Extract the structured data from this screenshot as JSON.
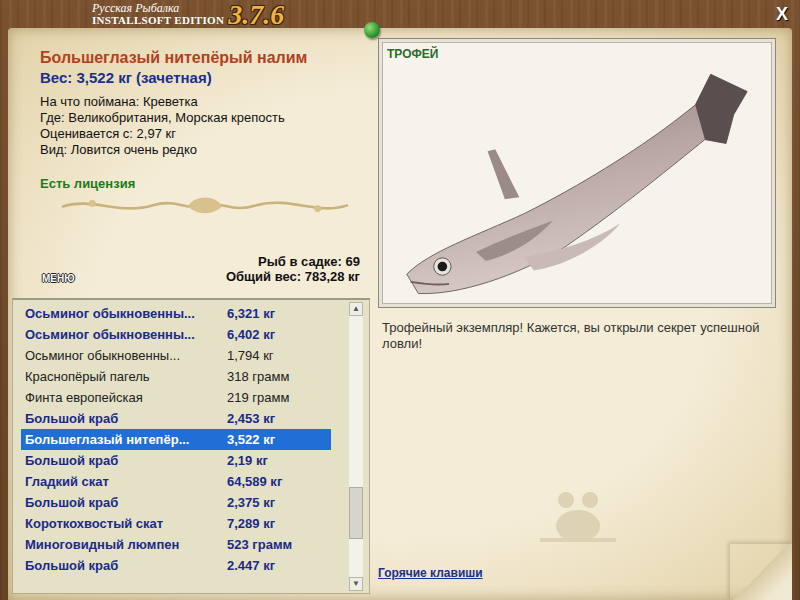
{
  "app": {
    "title": "Русская Рыбалка",
    "edition": "INSTALLSOFT EDITION",
    "version": "3.7.6",
    "close": "X"
  },
  "fish": {
    "name": "Большеглазый нитепёрый налим",
    "weight": "Вес: 3,522 кг (зачетная)",
    "details": [
      "На что поймана: Креветка",
      "Где: Великобритания, Морская крепость",
      "Оценивается с: 2,97 кг",
      "Вид: Ловится очень редко"
    ],
    "license": "Есть лицензия"
  },
  "keepnet": {
    "count": "Рыб в садке: 69",
    "total": "Общий вес: 783,28 кг"
  },
  "menu_button": "МЕНЮ",
  "list": {
    "rows": [
      {
        "name": "Осьминог обыкновенны...",
        "weight": "6,321 кг",
        "trophy": true,
        "selected": false
      },
      {
        "name": "Осьминог обыкновенны...",
        "weight": "6,402 кг",
        "trophy": true,
        "selected": false
      },
      {
        "name": "Осьминог обыкновенны...",
        "weight": "1,794 кг",
        "trophy": false,
        "selected": false
      },
      {
        "name": "Краснопёрый пагель",
        "weight": "318 грамм",
        "trophy": false,
        "selected": false
      },
      {
        "name": "Финта европейская",
        "weight": "219 грамм",
        "trophy": false,
        "selected": false
      },
      {
        "name": "Большой краб",
        "weight": "2,453 кг",
        "trophy": true,
        "selected": false
      },
      {
        "name": "Большеглазый нитепёр...",
        "weight": "3,522 кг",
        "trophy": true,
        "selected": true
      },
      {
        "name": "Большой краб",
        "weight": "2,19 кг",
        "trophy": true,
        "selected": false
      },
      {
        "name": "Гладкий скат",
        "weight": "64,589 кг",
        "trophy": true,
        "selected": false
      },
      {
        "name": "Большой краб",
        "weight": "2,375 кг",
        "trophy": true,
        "selected": false
      },
      {
        "name": "Короткохвостый скат",
        "weight": "7,289 кг",
        "trophy": true,
        "selected": false
      },
      {
        "name": "Миноговидный люмпен",
        "weight": "523 грамм",
        "trophy": true,
        "selected": false
      },
      {
        "name": "Большой краб",
        "weight": "2.447 кг",
        "trophy": true,
        "selected": false
      }
    ],
    "scroll": {
      "up": "▲",
      "down": "▼",
      "level": 0.82
    }
  },
  "photo": {
    "label": "ТРОФЕЙ"
  },
  "message": "Трофейный экземпляр! Кажется, вы открыли секрет успешной ловли!",
  "hotkeys": "Горячие клавиши"
}
